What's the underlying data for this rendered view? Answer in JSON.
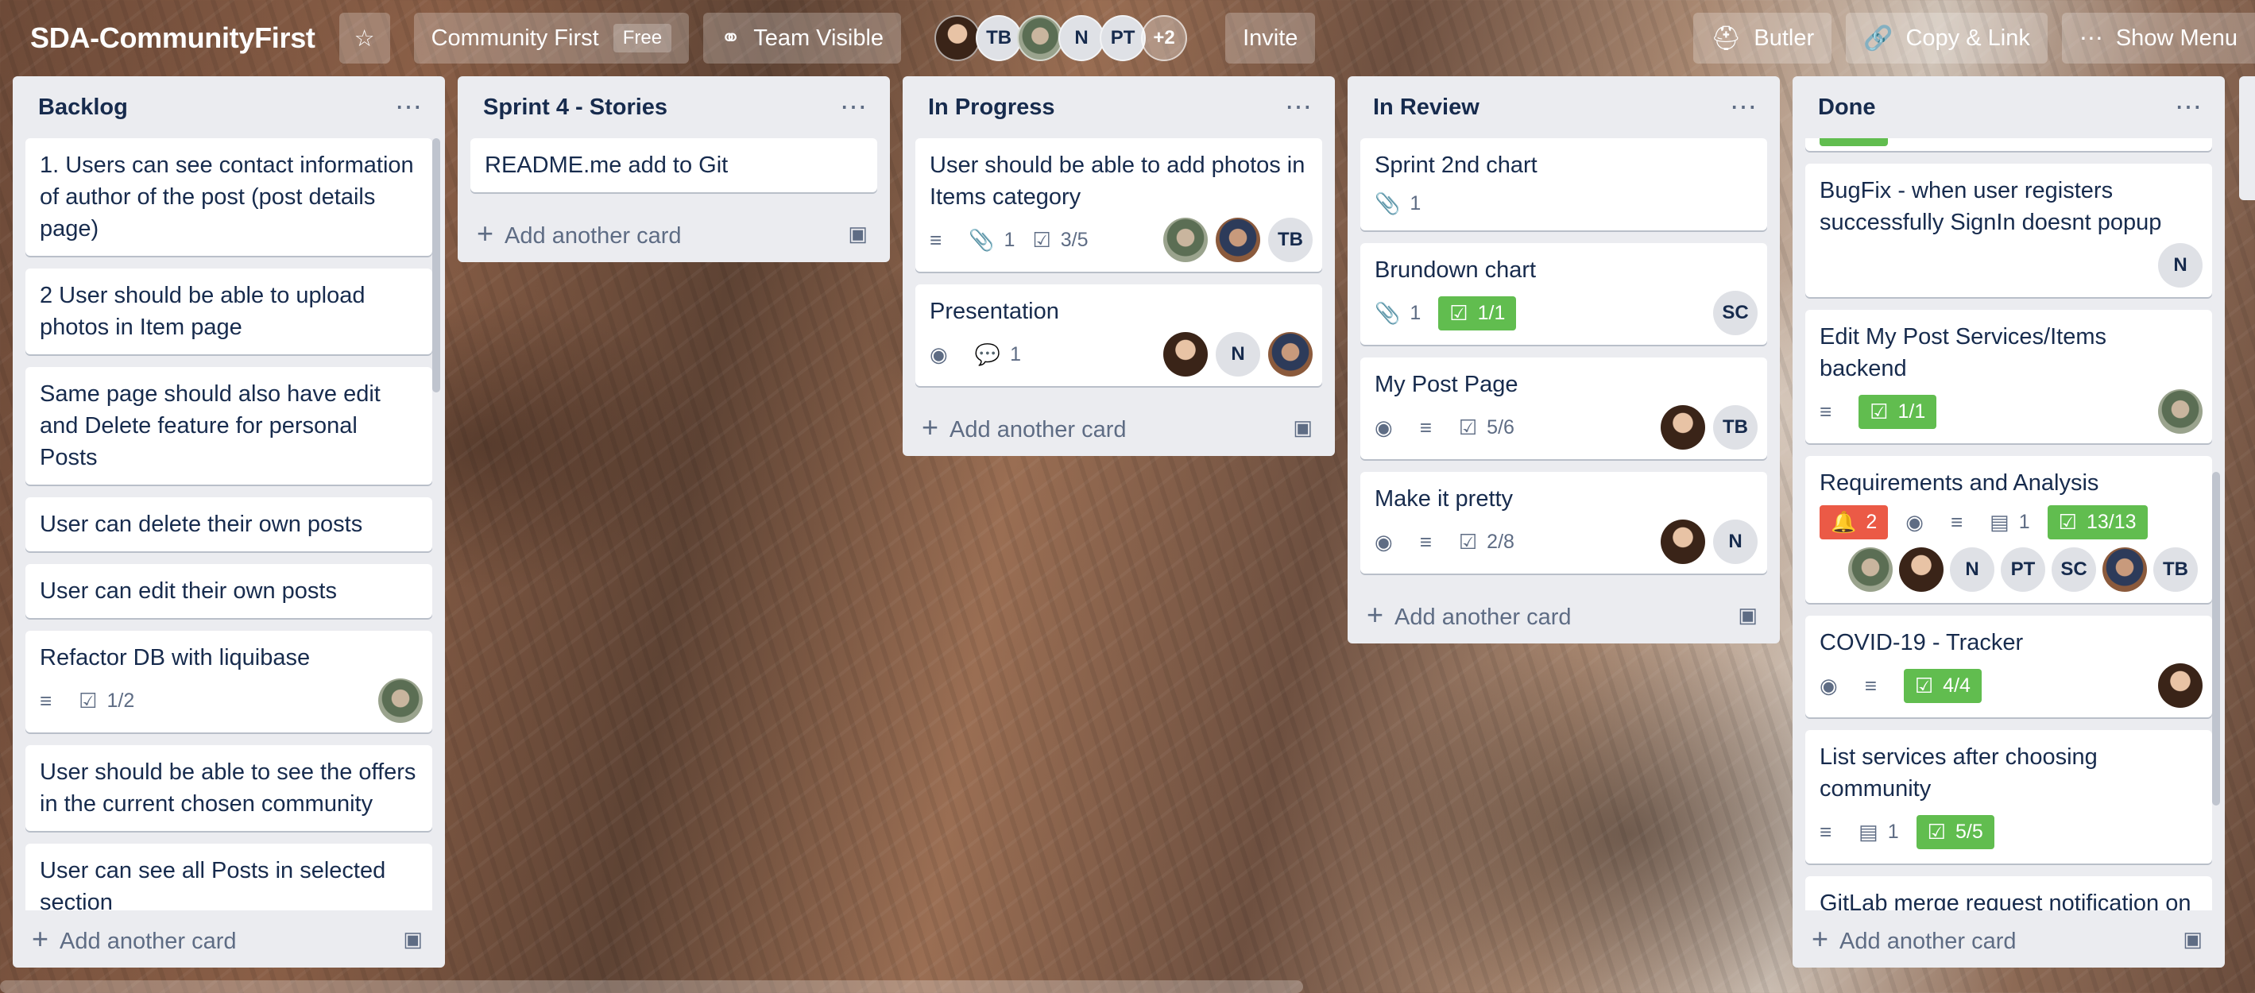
{
  "header": {
    "board_title": "SDA-CommunityFirst",
    "workspace_label": "Community First",
    "plan_badge": "Free",
    "visibility_label": "Team Visible",
    "members": [
      "TB",
      "N",
      "PT"
    ],
    "more_members": "+2",
    "invite_label": "Invite",
    "butler_label": "Butler",
    "copy_link_label": "Copy & Link",
    "show_menu_label": "Show Menu"
  },
  "add_card_label": "Add another card",
  "lists": [
    {
      "title": "Backlog",
      "cards": [
        {
          "title": "1. Users can see contact information of author of the post (post details page)"
        },
        {
          "title": "2 User should be able to upload photos in Item page"
        },
        {
          "title": "Same page should also have edit and Delete feature for personal Posts"
        },
        {
          "title": "User can delete their own posts"
        },
        {
          "title": "User can edit their own posts"
        },
        {
          "title": "Refactor DB with liquibase",
          "checklist": "1/2"
        },
        {
          "title": "User should be able to see the offers in the current chosen community"
        },
        {
          "title": "User can see all Posts in selected section"
        }
      ]
    },
    {
      "title": "Sprint 4 - Stories",
      "cards": [
        {
          "title": "README.me add to Git"
        }
      ]
    },
    {
      "title": "In Progress",
      "cards": [
        {
          "title": "User should be able to add photos in Items category",
          "attachments": "1",
          "checklist": "3/5",
          "members": [
            "TB"
          ]
        },
        {
          "title": "Presentation",
          "comments": "1",
          "members": [
            "N"
          ]
        }
      ]
    },
    {
      "title": "In Review",
      "cards": [
        {
          "title": "Sprint 2nd chart",
          "attachments": "1"
        },
        {
          "title": "Brundown chart",
          "attachments": "1",
          "checklist": "1/1",
          "members": [
            "SC"
          ]
        },
        {
          "title": "My Post Page",
          "checklist": "5/6",
          "members": [
            "TB"
          ]
        },
        {
          "title": "Make it pretty",
          "checklist": "2/8",
          "members": [
            "N"
          ]
        }
      ]
    },
    {
      "title": "Done",
      "cards": [
        {
          "title": "BugFix - when user registers successfully SignIn doesnt popup",
          "members": [
            "N"
          ]
        },
        {
          "title": "Edit My Post Services/Items backend",
          "checklist": "1/1"
        },
        {
          "title": "Requirements and Analysis",
          "notifications": "2",
          "board_count": "1",
          "checklist": "13/13",
          "members": [
            "N",
            "PT",
            "SC",
            "TB"
          ]
        },
        {
          "title": "COVID-19 - Tracker",
          "checklist": "4/4"
        },
        {
          "title": "List services after choosing community",
          "board_count": "1",
          "checklist": "5/5"
        },
        {
          "title": "GitLab merge request notification on Slack"
        }
      ]
    }
  ],
  "colors": {
    "checklist_complete": "#61bd4f",
    "notification": "#eb5a46",
    "list_bg": "#ebecf0"
  }
}
